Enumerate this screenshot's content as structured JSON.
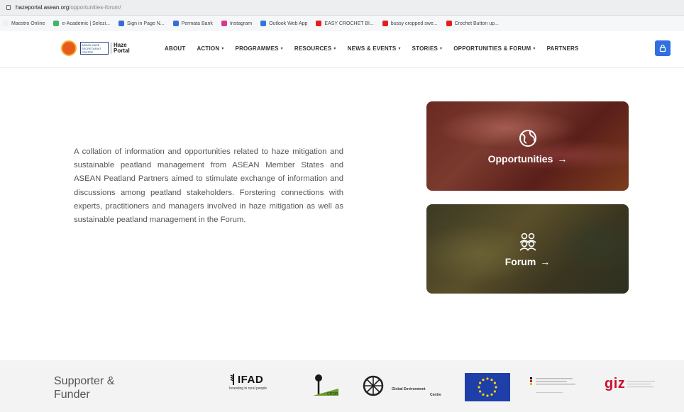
{
  "browser": {
    "url_host": "hazeportal.asean.org",
    "url_path": "/opportunities-forum/",
    "bookmarks": [
      {
        "label": "Maestro Online",
        "color": "#f0f0f0"
      },
      {
        "label": "e-Academic | Selezi...",
        "color": "#3fb56b"
      },
      {
        "label": "Sign in Page N...",
        "color": "#3b6ad8"
      },
      {
        "label": "Permata Bank",
        "color": "#3b6ad8"
      },
      {
        "label": "Instagram",
        "color": "#d63a8b"
      },
      {
        "label": "Outlook Web App",
        "color": "#2d7ad6"
      },
      {
        "label": "EASY CROCHET BI...",
        "color": "#e02020"
      },
      {
        "label": "bussy cropped swe...",
        "color": "#e02020"
      },
      {
        "label": "Crochet Button up...",
        "color": "#e02020"
      }
    ]
  },
  "header": {
    "logo_org": "ASEAN HAZE SECRETARIAT CENTRE",
    "logo_portal_line1": "Haze",
    "logo_portal_line2": "Portal",
    "nav": [
      {
        "label": "ABOUT",
        "has_caret": false
      },
      {
        "label": "ACTION",
        "has_caret": true
      },
      {
        "label": "PROGRAMMES",
        "has_caret": true
      },
      {
        "label": "RESOURCES",
        "has_caret": true
      },
      {
        "label": "NEWS & EVENTS",
        "has_caret": true
      },
      {
        "label": "STORIES",
        "has_caret": true
      },
      {
        "label": "OPPORTUNITIES & FORUM",
        "has_caret": true
      },
      {
        "label": "PARTNERS",
        "has_caret": false
      }
    ],
    "user_icon": "user-lock-icon",
    "accent": "#2f6fe0"
  },
  "intro": "A collation of information and opportunities related to haze mitigation and sustainable peatland management from ASEAN Member States and ASEAN Peatland Partners aimed to stimulate exchange of information and discussions among peatland stakeholders. Forstering connections with experts, practitioners and managers involved in haze mitigation as well as sustainable peatland management in the Forum.",
  "cards": [
    {
      "label": "Opportunities",
      "arrow": "→",
      "icon": "globe-icon"
    },
    {
      "label": "Forum",
      "arrow": "→",
      "icon": "users-icon"
    }
  ],
  "footer": {
    "title": "Supporter & Funder",
    "sponsors": {
      "ifad_name": "IFAD",
      "ifad_tag": "Investing in rural people",
      "cifor": "CIFOR",
      "gec_1": "Global Environment",
      "gec_2": "Centre",
      "giz": "giz"
    }
  }
}
